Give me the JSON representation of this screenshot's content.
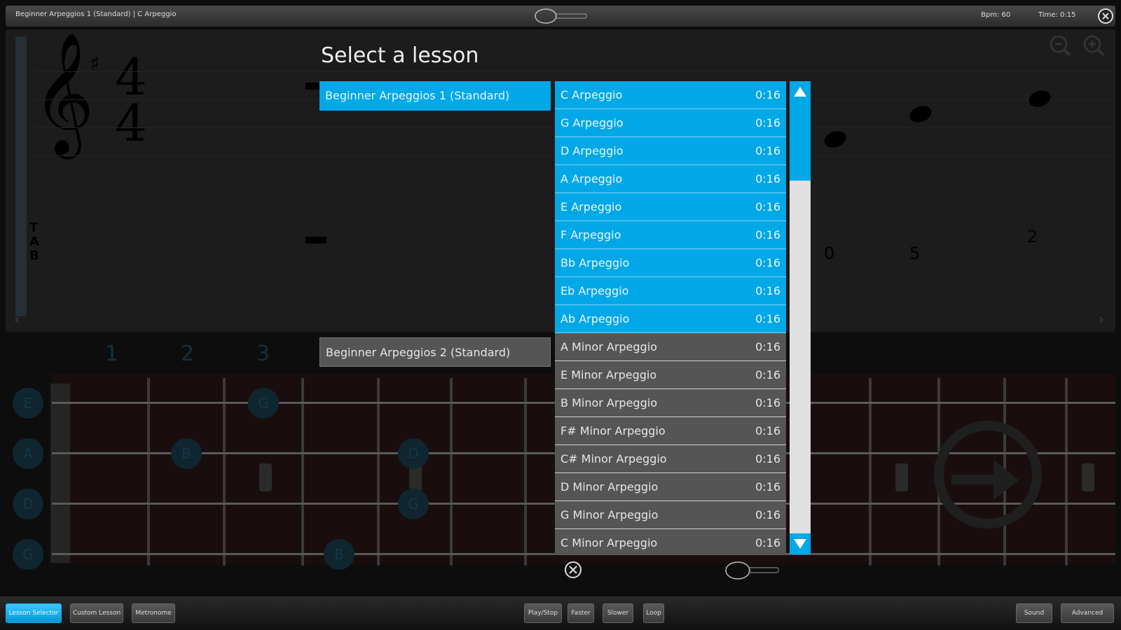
{
  "header": {
    "title": "Beginner Arpeggios 1 (Standard) | C Arpeggio",
    "bpm": "Bpm: 60",
    "time": "Time: 0:15"
  },
  "score": {
    "clef": "𝄞",
    "key_sharp": "♯",
    "time_sig_top": "4",
    "time_sig_bottom": "4",
    "tab_label": [
      "T",
      "A",
      "B"
    ],
    "tab_numbers": [
      "0",
      "5",
      "2"
    ]
  },
  "fretboard": {
    "fret_numbers": [
      "1",
      "2",
      "3"
    ],
    "open_notes": [
      "E",
      "A",
      "D",
      "G"
    ],
    "notes": [
      "G",
      "B",
      "D",
      "G",
      "B"
    ]
  },
  "modal": {
    "title": "Select a lesson",
    "categories": [
      {
        "label": "Beginner Arpeggios 1 (Standard)",
        "selected": true
      },
      {
        "label": "Beginner Arpeggios 2 (Standard)",
        "selected": false
      }
    ],
    "lessons": [
      {
        "name": "C Arpeggio",
        "duration": "0:16"
      },
      {
        "name": "G Arpeggio",
        "duration": "0:16"
      },
      {
        "name": "D Arpeggio",
        "duration": "0:16"
      },
      {
        "name": "A Arpeggio",
        "duration": "0:16"
      },
      {
        "name": "E Arpeggio",
        "duration": "0:16"
      },
      {
        "name": "F Arpeggio",
        "duration": "0:16"
      },
      {
        "name": "Bb Arpeggio",
        "duration": "0:16"
      },
      {
        "name": "Eb Arpeggio",
        "duration": "0:16"
      },
      {
        "name": "Ab Arpeggio",
        "duration": "0:16"
      },
      {
        "name": "A Minor Arpeggio",
        "duration": "0:16"
      },
      {
        "name": "E Minor Arpeggio",
        "duration": "0:16"
      },
      {
        "name": "B Minor Arpeggio",
        "duration": "0:16"
      },
      {
        "name": "F# Minor Arpeggio",
        "duration": "0:16"
      },
      {
        "name": "C# Minor Arpeggio",
        "duration": "0:16"
      },
      {
        "name": "D Minor Arpeggio",
        "duration": "0:16"
      },
      {
        "name": "G Minor Arpeggio",
        "duration": "0:16"
      },
      {
        "name": "C Minor Arpeggio",
        "duration": "0:16"
      }
    ],
    "highlighted_count": 9
  },
  "toolbar": {
    "lesson_selector": "Lesson Selector",
    "custom_lesson": "Custom Lesson",
    "metronome": "Metronome",
    "play_stop": "Play/Stop",
    "faster": "Faster",
    "slower": "Slower",
    "loop": "Loop",
    "sound": "Sound",
    "advanced": "Advanced"
  },
  "colors": {
    "accent": "#00a8e8",
    "item_gray": "#555555",
    "background": "#0d0d0d"
  }
}
